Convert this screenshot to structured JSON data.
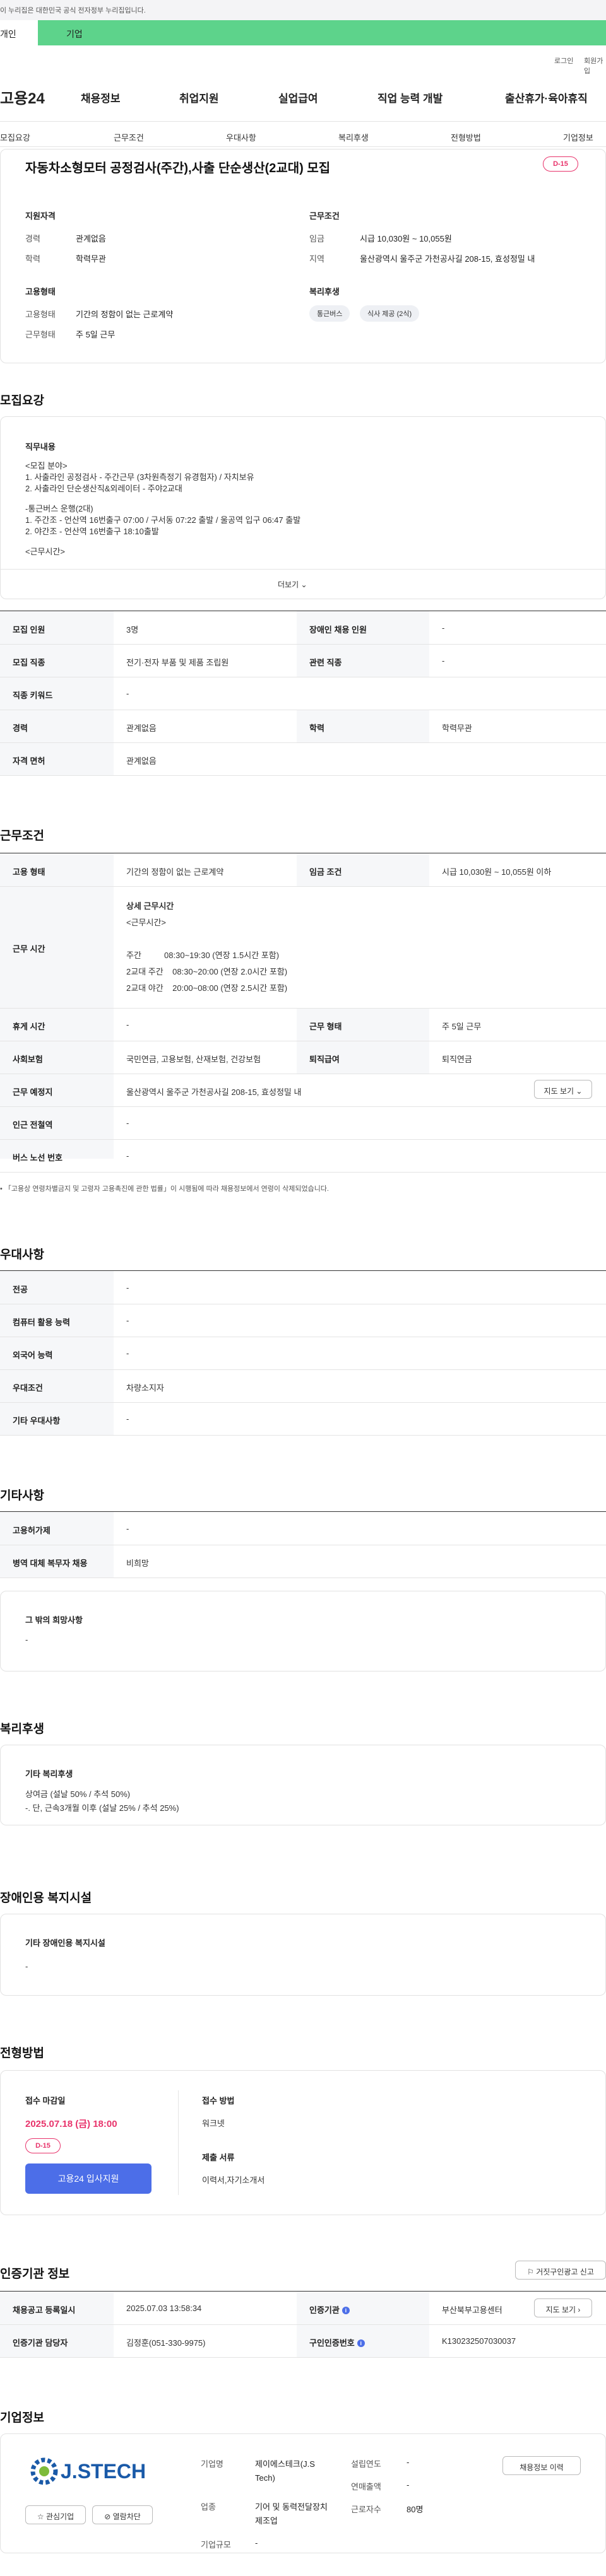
{
  "gov_banner": "이 누리집은 대한민국 공식 전자정부 누리집입니다.",
  "tabs": {
    "individual": "개인",
    "business": "기업"
  },
  "util": {
    "login": "로그인",
    "join": "회원가입"
  },
  "logo": "고용24",
  "gnb": [
    "채용정보",
    "취업지원",
    "실업급여",
    "직업 능력 개발",
    "출산휴가·육아휴직"
  ],
  "subnav": [
    "모집요강",
    "근무조건",
    "우대사항",
    "복리후생",
    "전형방법",
    "기업정보"
  ],
  "summary": {
    "title": "자동차소형모터 공정검사(주간),사출 단순생산(2교대) 모집",
    "dday": "D-15",
    "qual_heading": "지원자격",
    "career_k": "경력",
    "career_v": "관계없음",
    "edu_k": "학력",
    "edu_v": "학력무관",
    "cond_heading": "근무조건",
    "wage_k": "임금",
    "wage_v": "시급 10,030원 ~ 10,055원",
    "region_k": "지역",
    "region_v": "울산광역시 울주군 가천공사길 208-15, 효성정밀 내",
    "emp_heading": "고용형태",
    "emptype_k": "고용형태",
    "emptype_v": "기간의 정함이 없는 근로계약",
    "worktype_k": "근무형태",
    "worktype_v": "주 5일 근무",
    "welfare_heading": "복리후생",
    "chips": [
      "통근버스",
      "식사 제공 (2식)"
    ]
  },
  "recruit": {
    "heading": "모집요강",
    "duty_label": "직무내용",
    "duty_lines": [
      "<모집 분야>",
      "1. 사출라인 공정검사 - 주간근무 (3차원측정기 유경험자) / 자치보유",
      "2. 사출라인 단순생산직&외레이터 - 주야2교대",
      "",
      "-통근버스 운행(2대)",
      "1. 주간조 - 언산역 16번출구 07:00 / 구서동 07:22 출발 / 울공역 입구 06:47 출발",
      "2. 야간조 - 언산역 16번출구 18:10출발",
      "",
      "<근무시간>"
    ],
    "more": "더보기",
    "rows": [
      {
        "k1": "모집 인원",
        "v1": "3명",
        "k2": "장애인 채용 인원",
        "v2": "-"
      },
      {
        "k1": "모집 직종",
        "v1": "전기·전자 부품 및 제품 조립원",
        "k2": "관련 직종",
        "v2": "-"
      },
      {
        "k1": "직종 키워드",
        "v1": "-"
      },
      {
        "k1": "경력",
        "v1": "관계없음",
        "k2": "학력",
        "v2": "학력무관"
      },
      {
        "k1": "자격 면허",
        "v1": "관계없음"
      }
    ]
  },
  "work": {
    "heading": "근무조건",
    "emp_k": "고용 형태",
    "emp_v": "기간의 정함이 없는 근로계약",
    "wage_k": "임금 조건",
    "wage_v": "시급 10,030원 ~ 10,055원 이하",
    "time_k": "근무 시간",
    "time_lines": [
      "상세 근무시간",
      "<근무시간>",
      "",
      "주간          08:30~19:30 (연장 1.5시간 포함)",
      "2교대 주간    08:30~20:00 (연장 2.0시간 포함)",
      "2교대 야간    20:00~08:00 (연장 2.5시간 포함)"
    ],
    "holiday_k": "휴게 시간",
    "holiday_v": "-",
    "form_k": "근무 형태",
    "form_v": "주 5일 근무",
    "ins_k": "사회보험",
    "ins_v": "국민연금, 고용보험, 산재보험, 건강보험",
    "ret_k": "퇴직급여",
    "ret_v": "퇴직연금",
    "place_k": "근무 예정지",
    "place_v": "울산광역시 울주군 가천공사길 208-15, 효성정밀 내",
    "map_btn": "지도 보기",
    "subway_k": "인근 전철역",
    "subway_v": "-",
    "bus_k": "버스 노선 번호",
    "bus_v": "-",
    "note": "「고용상 연령차별금지 및 고령자 고용촉진에 관한 법률」이 시행됨에 따라 채용정보에서 연령이 삭제되었습니다."
  },
  "pref": {
    "heading": "우대사항",
    "rows": [
      {
        "k": "전공",
        "v": "-"
      },
      {
        "k": "컴퓨터 활용 능력",
        "v": "-"
      },
      {
        "k": "외국어 능력",
        "v": "-"
      },
      {
        "k": "우대조건",
        "v": "차량소지자"
      },
      {
        "k": "기타 우대사항",
        "v": "-"
      }
    ]
  },
  "etc": {
    "heading": "기타사항",
    "rows": [
      {
        "k": "고용허가제",
        "v": "-"
      },
      {
        "k": "병역 대체 복무자 채용",
        "v": "비희망"
      }
    ],
    "box_label": "그 밖의 희망사항",
    "box_v": "-"
  },
  "welfare": {
    "heading": "복리후생",
    "label": "기타 복리후생",
    "lines": [
      "상여금 (설날 50% / 추석 50%)",
      "-. 단, 근속3개월 이후 (설날 25% / 추석 25%)"
    ]
  },
  "disability": {
    "heading": "장애인용 복지시설",
    "label": "기타 장애인용 복지시설",
    "v": "-"
  },
  "selection": {
    "heading": "전형방법",
    "deadline_label": "접수 마감일",
    "deadline": "2025.07.18 (금) 18:00",
    "dday": "D-15",
    "apply_btn": "고용24 입사지원",
    "method_label": "접수 방법",
    "method_v": "워크넷",
    "docs_label": "제출 서류",
    "docs_v": "이력서,자기소개서"
  },
  "agency": {
    "heading": "인증기관 정보",
    "report_btn": "거짓구인광고 신고",
    "reg_k": "채용공고 등록일시",
    "reg_v": "2025.07.03 13:58:34",
    "org_k": "인증기관",
    "org_v": "부산북부고용센터",
    "map_btn": "지도 보기",
    "mgr_k": "인증기관 담당자",
    "mgr_v": "김정훈(051-330-9975)",
    "no_k": "구인인증번호",
    "no_v": "K130232507030037"
  },
  "company": {
    "heading": "기업정보",
    "logo_text": "J.STECH",
    "fav_btn": "관심기업",
    "block_btn": "열람차단",
    "name_k": "기업명",
    "name_v": "제이에스테크(J.S Tech)",
    "year_k": "설립연도",
    "year_v": "-",
    "sales_k": "연매출액",
    "sales_v": "-",
    "ind_k": "업종",
    "ind_v": "기어 및 동력전달장치 제조업",
    "emp_k": "근로자수",
    "emp_v": "80명",
    "size_k": "기업규모",
    "size_v": "-",
    "history_btn": "채용정보 이력"
  },
  "colors": {
    "brand_green": "#5dd38b",
    "accent_red": "#e8336b",
    "accent_blue": "#4c6ee8"
  }
}
